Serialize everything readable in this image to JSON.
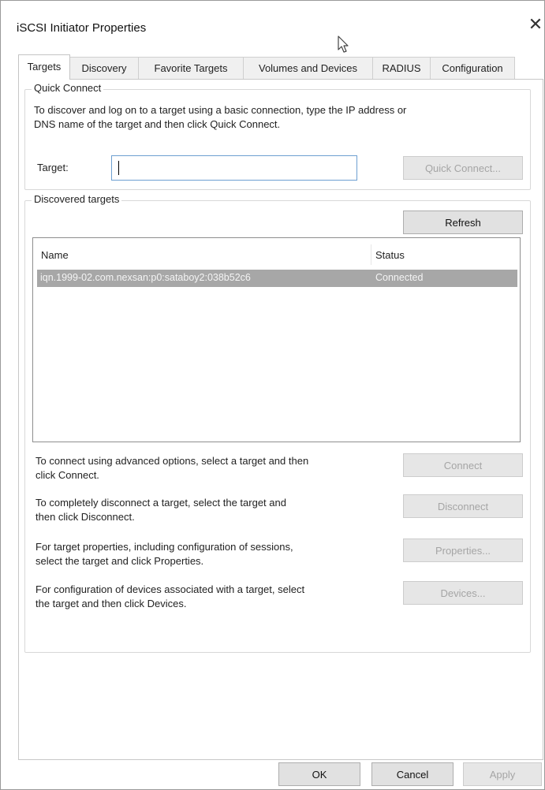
{
  "window": {
    "title": "iSCSI Initiator Properties",
    "close_glyph": "✕"
  },
  "tabs": [
    {
      "label": "Targets",
      "active": true
    },
    {
      "label": "Discovery"
    },
    {
      "label": "Favorite Targets"
    },
    {
      "label": "Volumes and Devices"
    },
    {
      "label": "RADIUS"
    },
    {
      "label": "Configuration"
    }
  ],
  "quick_connect": {
    "group_label": "Quick Connect",
    "instructions_line1": "To discover and log on to a target using a basic connection, type the IP address or",
    "instructions_line2": "DNS name of the target and then click Quick Connect.",
    "target_label": "Target:",
    "target_value": "",
    "button_label": "Quick Connect..."
  },
  "discovered": {
    "group_label": "Discovered targets",
    "refresh_label": "Refresh",
    "columns": {
      "name": "Name",
      "status": "Status"
    },
    "rows": [
      {
        "name": "iqn.1999-02.com.nexsan:p0:sataboy2:038b52c6",
        "status": "Connected",
        "selected": true
      }
    ]
  },
  "actions": [
    {
      "line1": "To connect using advanced options, select a target and then",
      "line2": "click Connect.",
      "button": "Connect"
    },
    {
      "line1": "To completely disconnect a target, select the target and",
      "line2": "then click Disconnect.",
      "button": "Disconnect"
    },
    {
      "line1": "For target properties, including configuration of sessions,",
      "line2": "select the target and click Properties.",
      "button": "Properties..."
    },
    {
      "line1": "For configuration of devices associated with a target, select",
      "line2": "the target and then click Devices.",
      "button": "Devices..."
    }
  ],
  "footer": {
    "ok": "OK",
    "cancel": "Cancel",
    "apply": "Apply"
  }
}
